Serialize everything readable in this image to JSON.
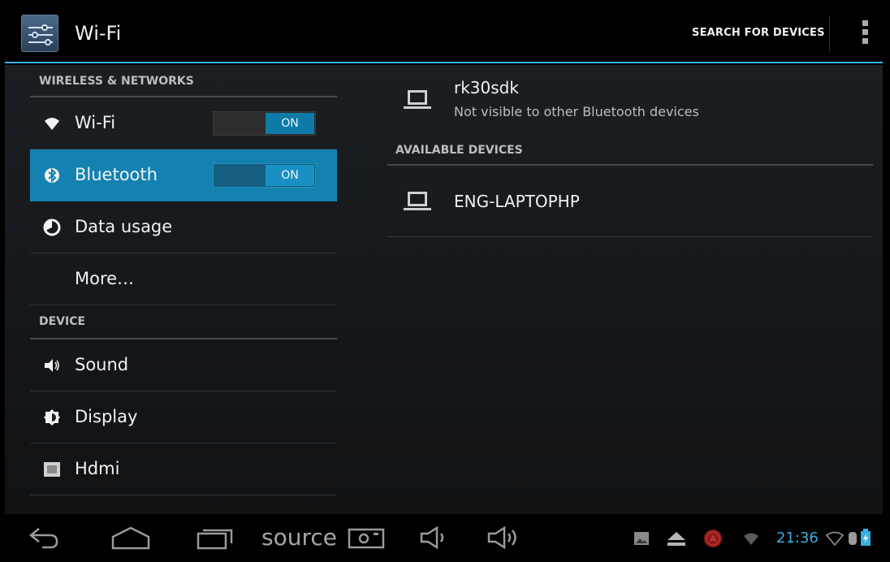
{
  "action_bar": {
    "title": "Wi-Fi",
    "search_label": "SEARCH FOR DEVICES",
    "app_icon": "settings-sliders-icon",
    "overflow_icon": "overflow-menu-icon",
    "accent_color": "#33b5e5"
  },
  "left_pane": {
    "section_wireless": "WIRELESS & NETWORKS",
    "wifi": {
      "label": "Wi-Fi",
      "icon": "wifi-icon",
      "toggle": "ON"
    },
    "bluetooth": {
      "label": "Bluetooth",
      "icon": "bluetooth-icon",
      "toggle": "ON"
    },
    "data_usage": {
      "label": "Data usage",
      "icon": "data-usage-icon"
    },
    "more": {
      "label": "More…"
    },
    "section_device": "DEVICE",
    "sound": {
      "label": "Sound",
      "icon": "sound-icon"
    },
    "display": {
      "label": "Display",
      "icon": "display-icon"
    },
    "hdmi": {
      "label": "Hdmi",
      "icon": "hdmi-icon"
    }
  },
  "right_pane": {
    "this_device": {
      "name": "rk30sdk",
      "status": "Not visible to other Bluetooth devices",
      "icon": "laptop-icon"
    },
    "available_header": "AVAILABLE DEVICES",
    "available_devices": [
      {
        "name": "ENG-LAPTOPHP",
        "icon": "laptop-icon"
      }
    ]
  },
  "nav_bar": {
    "source_label": "source",
    "time": "21:36",
    "clock_color": "#35b0e0",
    "buttons": [
      "back-icon",
      "home-icon",
      "recent-apps-icon",
      "screenshot-icon",
      "volume-down-icon",
      "volume-up-icon"
    ],
    "status_icons": [
      "gallery-icon",
      "eject-icon",
      "notification-a-icon",
      "wifi-status-icon",
      "signal-icon",
      "bluetooth-status-icon",
      "battery-icon"
    ]
  }
}
